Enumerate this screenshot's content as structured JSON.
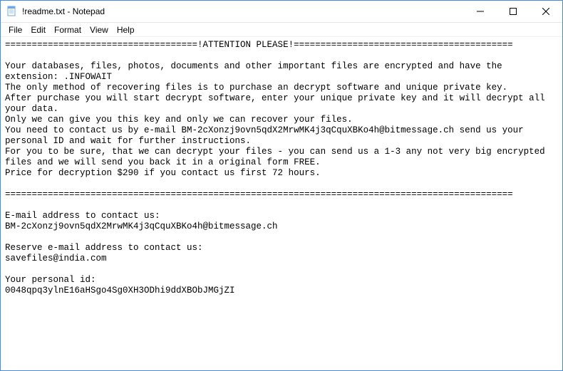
{
  "window": {
    "title": "!readme.txt - Notepad"
  },
  "menu": {
    "file": "File",
    "edit": "Edit",
    "format": "Format",
    "view": "View",
    "help": "Help"
  },
  "document": {
    "text": "====================================!ATTENTION PLEASE!=========================================\n\nYour databases, files, photos, documents and other important files are encrypted and have the extension: .INFOWAIT\nThe only method of recovering files is to purchase an decrypt software and unique private key.\nAfter purchase you will start decrypt software, enter your unique private key and it will decrypt all your data.\nOnly we can give you this key and only we can recover your files.\nYou need to contact us by e-mail BM-2cXonzj9ovn5qdX2MrwMK4j3qCquXBKo4h@bitmessage.ch send us your personal ID and wait for further instructions.\nFor you to be sure, that we can decrypt your files - you can send us a 1-3 any not very big encrypted files and we will send you back it in a original form FREE.\nPrice for decryption $290 if you contact us first 72 hours.\n\n===============================================================================================\n\nE-mail address to contact us:\nBM-2cXonzj9ovn5qdX2MrwMK4j3qCquXBKo4h@bitmessage.ch\n\nReserve e-mail address to contact us:\nsavefiles@india.com\n\nYour personal id:\n0048qpq3ylnE16aHSgo4Sg0XH3ODhi9ddXBObJMGjZI"
  }
}
